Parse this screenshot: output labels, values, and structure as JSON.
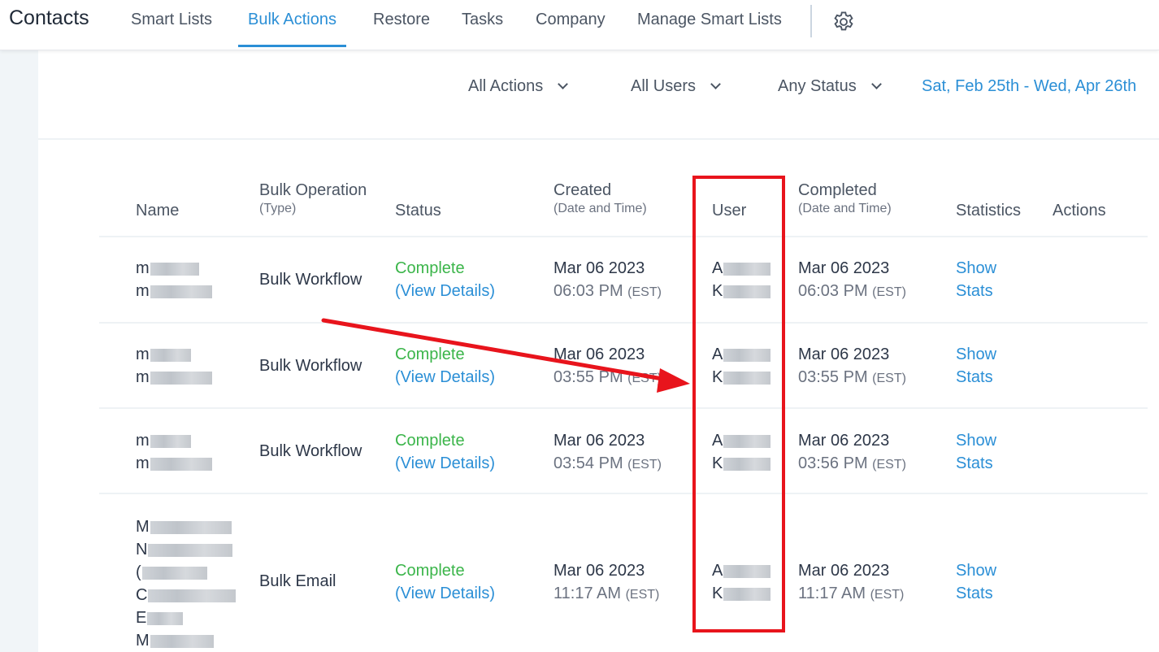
{
  "header": {
    "app_title": "Contacts",
    "tabs": [
      {
        "label": "Smart Lists"
      },
      {
        "label": "Bulk Actions"
      },
      {
        "label": "Restore"
      },
      {
        "label": "Tasks"
      },
      {
        "label": "Company"
      },
      {
        "label": "Manage Smart Lists"
      }
    ],
    "active_tab": "Bulk Actions",
    "settings_icon": "gear-icon"
  },
  "filters": {
    "actions": "All Actions",
    "users": "All Users",
    "status": "Any Status",
    "date_range": "Sat, Feb 25th - Wed, Apr 26th"
  },
  "table": {
    "columns": [
      {
        "label": "Name",
        "sub": ""
      },
      {
        "label": "Bulk Operation",
        "sub": "(Type)"
      },
      {
        "label": "Status",
        "sub": ""
      },
      {
        "label": "Created",
        "sub": "(Date and Time)"
      },
      {
        "label": "User",
        "sub": ""
      },
      {
        "label": "Completed",
        "sub": "(Date and Time)"
      },
      {
        "label": "Statistics",
        "sub": ""
      },
      {
        "label": "Actions",
        "sub": ""
      }
    ],
    "rows": [
      {
        "name_lines": [
          "m",
          "m"
        ],
        "type": "Bulk Workflow",
        "status": "Complete",
        "details": "(View Details)",
        "created_date": "Mar 06 2023",
        "created_time": "06:03 PM",
        "created_tz": "(EST)",
        "user_lines": [
          "A",
          "K"
        ],
        "completed_date": "Mar 06 2023",
        "completed_time": "06:03 PM",
        "completed_tz": "(EST)",
        "stats_1": "Show",
        "stats_2": "Stats"
      },
      {
        "name_lines": [
          "m",
          "m"
        ],
        "type": "Bulk Workflow",
        "status": "Complete",
        "details": "(View Details)",
        "created_date": "Mar 06 2023",
        "created_time": "03:55 PM",
        "created_tz": "(EST)",
        "user_lines": [
          "A",
          "K"
        ],
        "completed_date": "Mar 06 2023",
        "completed_time": "03:55 PM",
        "completed_tz": "(EST)",
        "stats_1": "Show",
        "stats_2": "Stats"
      },
      {
        "name_lines": [
          "m",
          "m"
        ],
        "type": "Bulk Workflow",
        "status": "Complete",
        "details": "(View Details)",
        "created_date": "Mar 06 2023",
        "created_time": "03:54 PM",
        "created_tz": "(EST)",
        "user_lines": [
          "A",
          "K"
        ],
        "completed_date": "Mar 06 2023",
        "completed_time": "03:56 PM",
        "completed_tz": "(EST)",
        "stats_1": "Show",
        "stats_2": "Stats"
      },
      {
        "name_lines": [
          "M",
          "N",
          "(",
          "C",
          "E",
          "M"
        ],
        "type": "Bulk Email",
        "status": "Complete",
        "details": "(View Details)",
        "created_date": "Mar 06 2023",
        "created_time": "11:17 AM",
        "created_tz": "(EST)",
        "user_lines": [
          "A",
          "K"
        ],
        "completed_date": "Mar 06 2023",
        "completed_time": "11:17 AM",
        "completed_tz": "(EST)",
        "stats_1": "Show",
        "stats_2": "Stats"
      }
    ]
  },
  "annotation": {
    "highlight_color": "#e8141c"
  }
}
